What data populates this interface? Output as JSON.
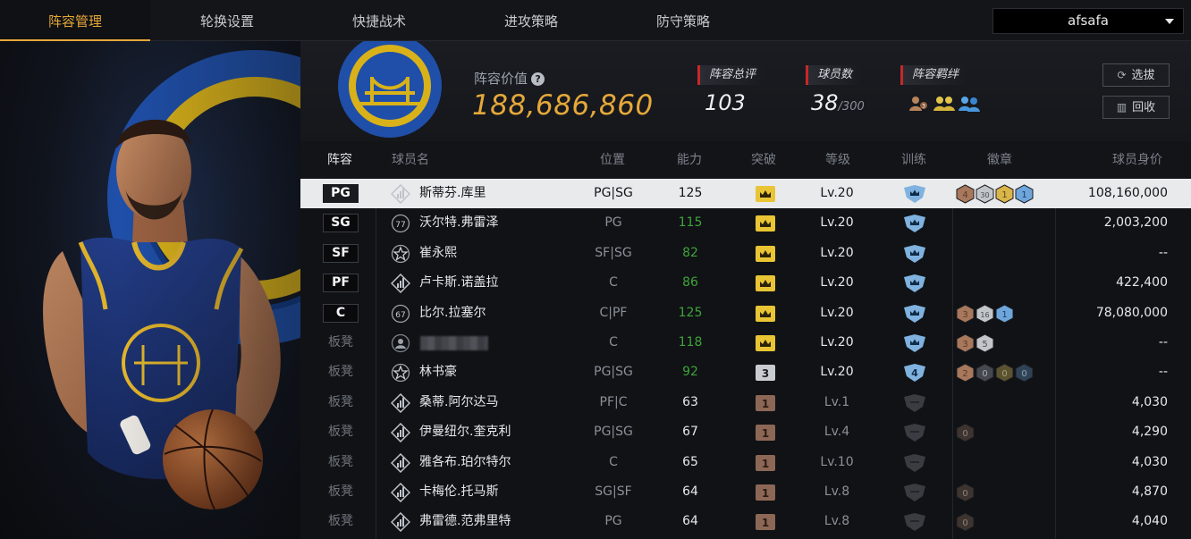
{
  "nav": {
    "tabs": [
      "阵容管理",
      "轮换设置",
      "快捷战术",
      "进攻策略",
      "防守策略"
    ],
    "active_index": 0,
    "account": "afsafa"
  },
  "team": {
    "value_label": "阵容价值",
    "value": "188,686,860",
    "rating_label": "阵容总评",
    "rating": "103",
    "players_label": "球员数",
    "players": "38",
    "players_max": "/300",
    "bond_label": "阵容羁绊",
    "select_button": "选拔",
    "recycle_button": "回收"
  },
  "table": {
    "headers": {
      "lineup": "阵容",
      "name": "球员名",
      "position": "位置",
      "ability": "能力",
      "breakthrough": "突破",
      "level": "等级",
      "training": "训练",
      "badges": "徽章",
      "value": "球员身价"
    },
    "rows": [
      {
        "slot": "PG",
        "icon": "signal",
        "icon_text": "",
        "name": "斯蒂芬.库里",
        "pos": "PG|SG",
        "ability": "125",
        "brk": "crown",
        "level": "Lv.20",
        "train": "crown",
        "badges": [
          {
            "c": "bronze",
            "t": "4"
          },
          {
            "c": "silver",
            "t": "30"
          },
          {
            "c": "gold",
            "t": "1"
          },
          {
            "c": "blue",
            "t": "1"
          }
        ],
        "value": "108,160,000",
        "selected": true,
        "green": false,
        "sub": false
      },
      {
        "slot": "SG",
        "icon": "circle",
        "icon_text": "77",
        "name": "沃尔特.弗雷泽",
        "pos": "PG",
        "ability": "115",
        "brk": "crown",
        "level": "Lv.20",
        "train": "crown",
        "badges": [],
        "value": "2,003,200",
        "selected": false,
        "green": true,
        "sub": false
      },
      {
        "slot": "SF",
        "icon": "star",
        "icon_text": "",
        "name": "崔永熙",
        "pos": "SF|SG",
        "ability": "82",
        "brk": "crown",
        "level": "Lv.20",
        "train": "crown",
        "badges": [],
        "value": "--",
        "selected": false,
        "green": true,
        "sub": false
      },
      {
        "slot": "PF",
        "icon": "signal",
        "icon_text": "",
        "name": "卢卡斯.诺盖拉",
        "pos": "C",
        "ability": "86",
        "brk": "crown",
        "level": "Lv.20",
        "train": "crown",
        "badges": [],
        "value": "422,400",
        "selected": false,
        "green": true,
        "sub": false
      },
      {
        "slot": "C",
        "icon": "circle",
        "icon_text": "67",
        "name": "比尔.拉塞尔",
        "pos": "C|PF",
        "ability": "125",
        "brk": "crown",
        "level": "Lv.20",
        "train": "crown",
        "badges": [
          {
            "c": "bronze",
            "t": "3"
          },
          {
            "c": "silver",
            "t": "16"
          },
          {
            "c": "blue",
            "t": "1"
          }
        ],
        "value": "78,080,000",
        "selected": false,
        "green": true,
        "sub": false
      },
      {
        "slot": "板凳",
        "icon": "avatar",
        "icon_text": "",
        "name": "",
        "pos": "C",
        "ability": "118",
        "brk": "crown",
        "level": "Lv.20",
        "train": "crown",
        "badges": [
          {
            "c": "bronze",
            "t": "3"
          },
          {
            "c": "silver",
            "t": "5"
          }
        ],
        "value": "--",
        "selected": false,
        "green": true,
        "sub": true,
        "blurred": true
      },
      {
        "slot": "板凳",
        "icon": "star",
        "icon_text": "",
        "name": "林书豪",
        "pos": "PG|SG",
        "ability": "92",
        "brk": "num3",
        "level": "Lv.20",
        "train": "num4",
        "badges": [
          {
            "c": "bronze",
            "t": "2"
          },
          {
            "c": "dark",
            "t": "0"
          },
          {
            "c": "darkgold",
            "t": "0"
          },
          {
            "c": "darkblue",
            "t": "0"
          }
        ],
        "value": "--",
        "selected": false,
        "green": true,
        "sub": true
      },
      {
        "slot": "板凳",
        "icon": "signal",
        "icon_text": "",
        "name": "桑蒂.阿尔达马",
        "pos": "PF|C",
        "ability": "63",
        "brk": "num1",
        "level": "Lv.1",
        "train": "empty",
        "badges": [],
        "value": "4,030",
        "selected": false,
        "green": false,
        "sub": true
      },
      {
        "slot": "板凳",
        "icon": "signal",
        "icon_text": "",
        "name": "伊曼纽尔.奎克利",
        "pos": "PG|SG",
        "ability": "67",
        "brk": "num1",
        "level": "Lv.4",
        "train": "empty",
        "badges": [
          {
            "c": "darkbronze",
            "t": "0"
          }
        ],
        "value": "4,290",
        "selected": false,
        "green": false,
        "sub": true
      },
      {
        "slot": "板凳",
        "icon": "signal",
        "icon_text": "",
        "name": "雅各布.珀尔特尔",
        "pos": "C",
        "ability": "65",
        "brk": "num1",
        "level": "Lv.10",
        "train": "empty",
        "badges": [],
        "value": "4,030",
        "selected": false,
        "green": false,
        "sub": true
      },
      {
        "slot": "板凳",
        "icon": "signal",
        "icon_text": "",
        "name": "卡梅伦.托马斯",
        "pos": "SG|SF",
        "ability": "64",
        "brk": "num1",
        "level": "Lv.8",
        "train": "empty",
        "badges": [
          {
            "c": "darkbronze",
            "t": "0"
          }
        ],
        "value": "4,870",
        "selected": false,
        "green": false,
        "sub": true
      },
      {
        "slot": "板凳",
        "icon": "signal",
        "icon_text": "",
        "name": "弗雷德.范弗里特",
        "pos": "PG",
        "ability": "64",
        "brk": "num1",
        "level": "Lv.8",
        "train": "empty",
        "badges": [
          {
            "c": "darkbronze",
            "t": "0"
          }
        ],
        "value": "4,040",
        "selected": false,
        "green": false,
        "sub": true
      }
    ]
  },
  "colors": {
    "accent": "#e6a83a",
    "green": "#3fa33a",
    "warriors_blue": "#1f4fa8",
    "warriors_gold": "#d9b21a"
  }
}
